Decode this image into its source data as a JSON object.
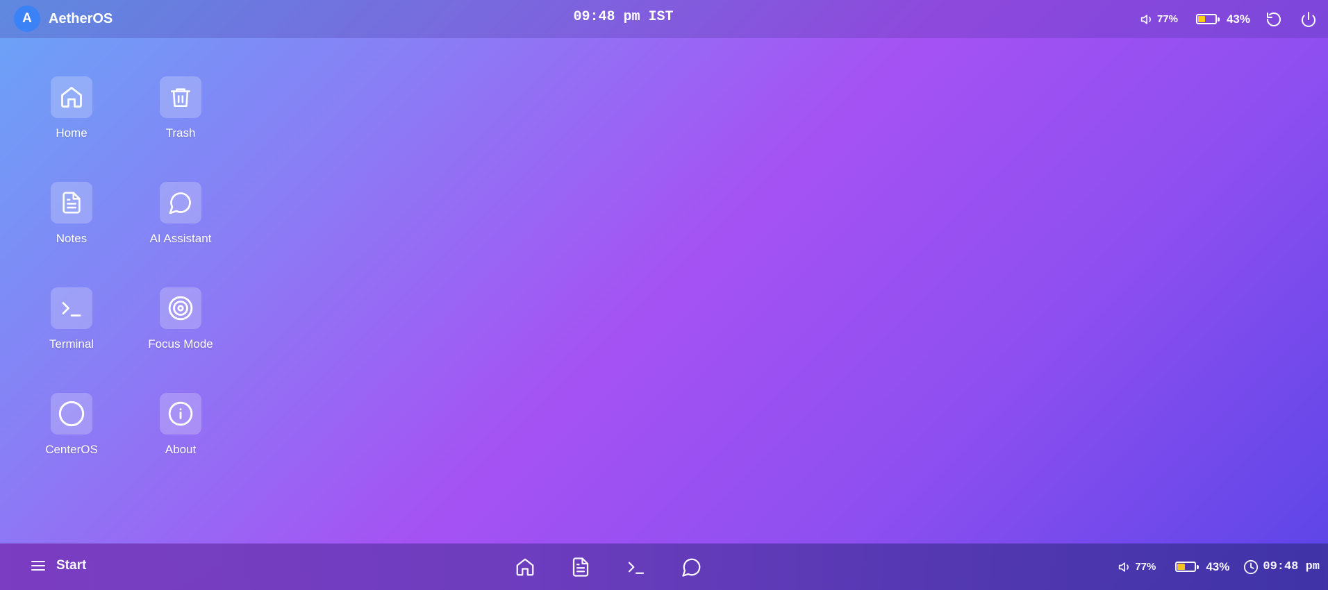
{
  "topbar": {
    "avatar_letter": "A",
    "brand": "AetherOS",
    "clock": "09:48 pm IST",
    "volume": "77%",
    "battery": "43%",
    "battery_level": 0.43
  },
  "desktop": {
    "apps": [
      {
        "label": "Home",
        "icon": "home-icon"
      },
      {
        "label": "Trash",
        "icon": "trash-icon"
      },
      {
        "label": "Notes",
        "icon": "notes-icon"
      },
      {
        "label": "AI Assistant",
        "icon": "chat-bubble-icon"
      },
      {
        "label": "Terminal",
        "icon": "terminal-icon"
      },
      {
        "label": "Focus Mode",
        "icon": "target-icon"
      },
      {
        "label": "CenterOS",
        "icon": "circle-icon"
      },
      {
        "label": "About",
        "icon": "info-icon"
      }
    ]
  },
  "taskbar": {
    "start_label": "Start",
    "pinned": [
      "home-icon",
      "notes-icon",
      "terminal-icon",
      "chat-bubble-icon"
    ],
    "volume": "77%",
    "battery": "43%",
    "battery_level": 0.43,
    "clock": "09:48 pm"
  },
  "colors": {
    "avatar": "#3b82f6",
    "battery_fill": "#facc15"
  }
}
